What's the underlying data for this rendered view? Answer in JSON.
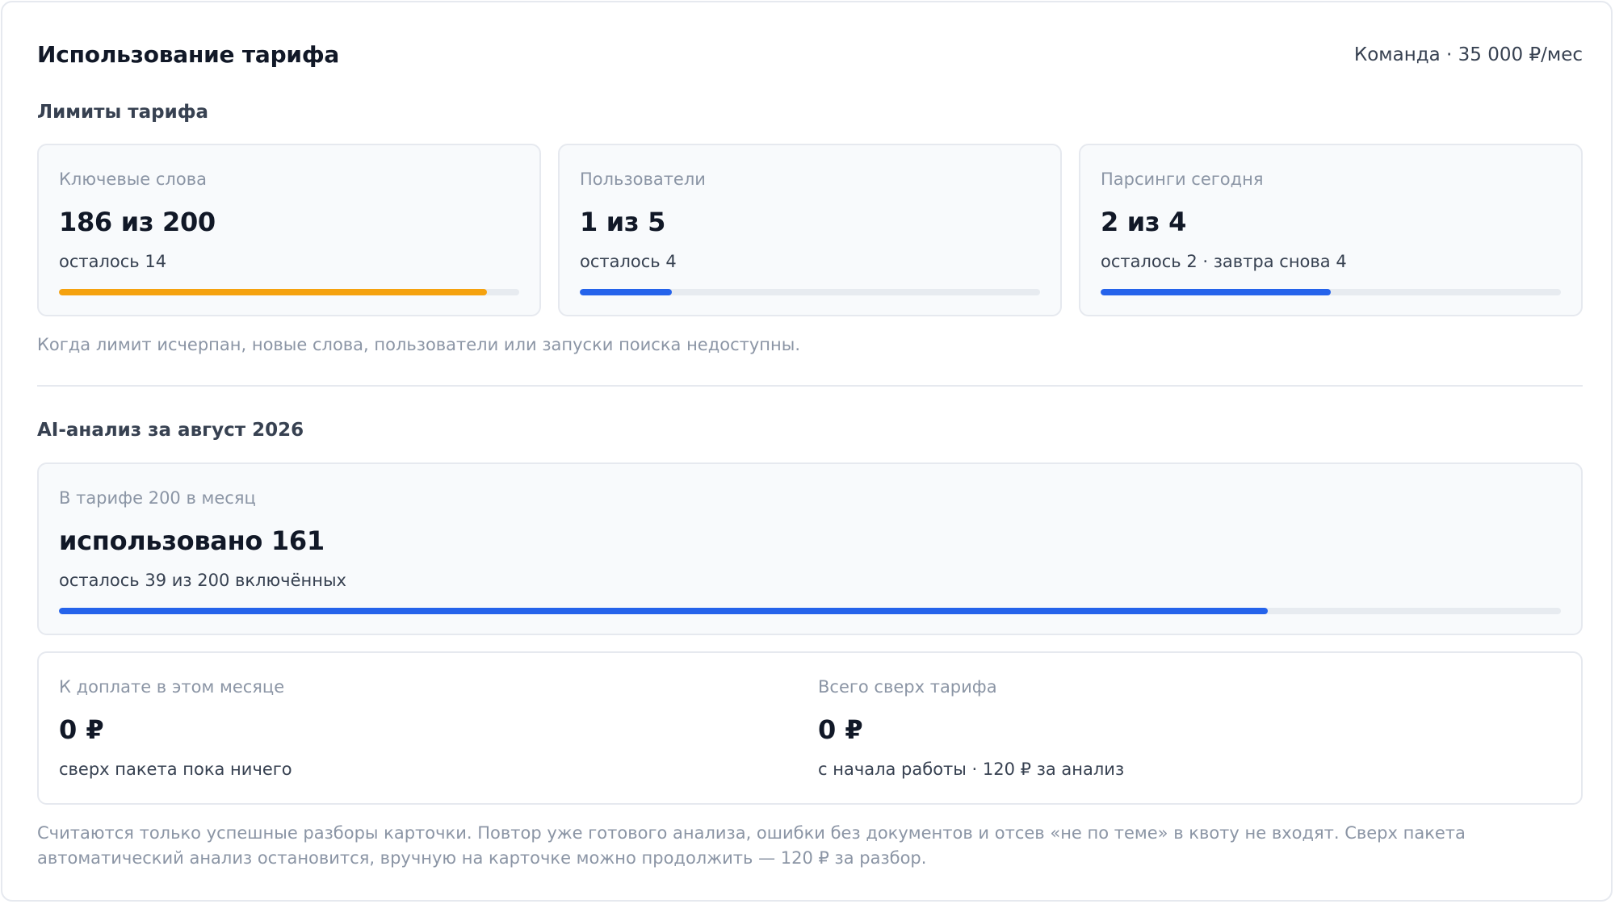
{
  "header": {
    "title": "Использование тарифа",
    "plan": "Команда · 35 000 ₽/мес"
  },
  "limits": {
    "section_label": "Лимиты тарифа",
    "cards": [
      {
        "label": "Ключевые слова",
        "value": "186 из 200",
        "sub": "осталось 14",
        "progress": 0.93,
        "color": "#f5a20f"
      },
      {
        "label": "Пользователи",
        "value": "1 из 5",
        "sub": "осталось 4",
        "progress": 0.2,
        "color": "#2563eb"
      },
      {
        "label": "Парсинги сегодня",
        "value": "2 из 4",
        "sub": "осталось 2 · завтра снова 4",
        "progress": 0.5,
        "color": "#2563eb"
      }
    ],
    "note": "Когда лимит исчерпан, новые слова, пользователи или запуски поиска недоступны."
  },
  "ai": {
    "section_label": "AI-анализ за август 2026",
    "card": {
      "label": "В тарифе 200 в месяц",
      "value": "использовано 161",
      "sub": "осталось 39 из 200 включённых",
      "progress": 0.805,
      "color": "#2563eb"
    }
  },
  "payment": {
    "left": {
      "label": "К доплате в этом месяце",
      "value": "0 ₽",
      "sub": "сверх пакета пока ничего"
    },
    "right": {
      "label": "Всего сверх тарифа",
      "value": "0 ₽",
      "sub": "с начала работы · 120 ₽ за анализ"
    }
  },
  "footer_note": "Считаются только успешные разборы карточки. Повтор уже готового анализа, ошибки без документов и отсев «не по теме» в квоту не входят. Сверх пакета автоматический анализ остановится, вручную на карточке можно продолжить — 120 ₽ за разбор."
}
